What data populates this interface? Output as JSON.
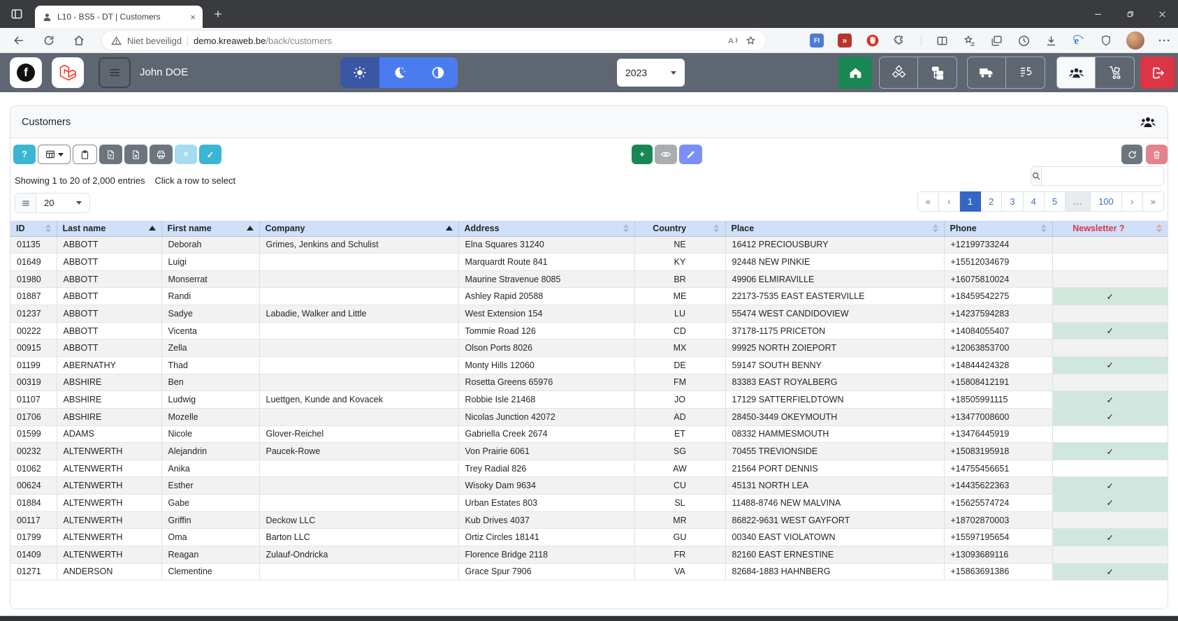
{
  "browser": {
    "tab_title": "L10 - BS5 - DT | Customers",
    "security_label": "Niet beveiligd",
    "url_host": "demo.kreaweb.be",
    "url_path": "/back/customers"
  },
  "header": {
    "user_name": "John DOE",
    "year": "2023"
  },
  "icons": {
    "close_tab": "×",
    "facebook_glyph": "f",
    "more": "···"
  },
  "panel": {
    "title": "Customers",
    "toolbar": {
      "help": "?",
      "clear": "×",
      "apply": "✓",
      "add": "+"
    },
    "info": {
      "showing": "Showing 1 to 20 of 2,000 entries",
      "hint": "Click a row to select"
    },
    "length_value": "20",
    "search_value": "",
    "pagination": {
      "first": "«",
      "prev": "‹",
      "next": "›",
      "last": "»",
      "pages": [
        "1",
        "2",
        "3",
        "4",
        "5",
        "…",
        "100"
      ],
      "active": "1"
    },
    "table": {
      "columns": [
        {
          "label": "ID",
          "sort": "both",
          "align": "left"
        },
        {
          "label": "Last name",
          "sort": "asc",
          "align": "left"
        },
        {
          "label": "First name",
          "sort": "asc",
          "align": "left"
        },
        {
          "label": "Company",
          "sort": "asc",
          "align": "left"
        },
        {
          "label": "Address",
          "sort": "both",
          "align": "left"
        },
        {
          "label": "Country",
          "sort": "both",
          "align": "center"
        },
        {
          "label": "Place",
          "sort": "both",
          "align": "left"
        },
        {
          "label": "Phone",
          "sort": "both",
          "align": "left"
        },
        {
          "label": "Newsletter ?",
          "sort": "both",
          "align": "center",
          "accent": "danger"
        }
      ],
      "check_glyph": "✓",
      "rows": [
        {
          "id": "01135",
          "last": "ABBOTT",
          "first": "Deborah",
          "company": "Grimes, Jenkins and Schulist",
          "address": "Elna Squares 31240",
          "country": "NE",
          "place": "16412 PRECIOUSBURY",
          "phone": "+12199733244",
          "newsletter": false
        },
        {
          "id": "01649",
          "last": "ABBOTT",
          "first": "Luigi",
          "company": "",
          "address": "Marquardt Route 841",
          "country": "KY",
          "place": "92448 NEW PINKIE",
          "phone": "+15512034679",
          "newsletter": false
        },
        {
          "id": "01980",
          "last": "ABBOTT",
          "first": "Monserrat",
          "company": "",
          "address": "Maurine Stravenue 8085",
          "country": "BR",
          "place": "49906 ELMIRAVILLE",
          "phone": "+16075810024",
          "newsletter": false
        },
        {
          "id": "01887",
          "last": "ABBOTT",
          "first": "Randi",
          "company": "",
          "address": "Ashley Rapid 20588",
          "country": "ME",
          "place": "22173-7535 EAST EASTERVILLE",
          "phone": "+18459542275",
          "newsletter": true
        },
        {
          "id": "01237",
          "last": "ABBOTT",
          "first": "Sadye",
          "company": "Labadie, Walker and Little",
          "address": "West Extension 154",
          "country": "LU",
          "place": "55474 WEST CANDIDOVIEW",
          "phone": "+14237594283",
          "newsletter": false
        },
        {
          "id": "00222",
          "last": "ABBOTT",
          "first": "Vicenta",
          "company": "",
          "address": "Tommie Road 126",
          "country": "CD",
          "place": "37178-1175 PRICETON",
          "phone": "+14084055407",
          "newsletter": true
        },
        {
          "id": "00915",
          "last": "ABBOTT",
          "first": "Zella",
          "company": "",
          "address": "Olson Ports 8026",
          "country": "MX",
          "place": "99925 NORTH ZOIEPORT",
          "phone": "+12063853700",
          "newsletter": false
        },
        {
          "id": "01199",
          "last": "ABERNATHY",
          "first": "Thad",
          "company": "",
          "address": "Monty Hills 12060",
          "country": "DE",
          "place": "59147 SOUTH BENNY",
          "phone": "+14844424328",
          "newsletter": true
        },
        {
          "id": "00319",
          "last": "ABSHIRE",
          "first": "Ben",
          "company": "",
          "address": "Rosetta Greens 65976",
          "country": "FM",
          "place": "83383 EAST ROYALBERG",
          "phone": "+15808412191",
          "newsletter": false
        },
        {
          "id": "01107",
          "last": "ABSHIRE",
          "first": "Ludwig",
          "company": "Luettgen, Kunde and Kovacek",
          "address": "Robbie Isle 21468",
          "country": "JO",
          "place": "17129 SATTERFIELDTOWN",
          "phone": "+18505991115",
          "newsletter": true
        },
        {
          "id": "01706",
          "last": "ABSHIRE",
          "first": "Mozelle",
          "company": "",
          "address": "Nicolas Junction 42072",
          "country": "AD",
          "place": "28450-3449 OKEYMOUTH",
          "phone": "+13477008600",
          "newsletter": true
        },
        {
          "id": "01599",
          "last": "ADAMS",
          "first": "Nicole",
          "company": "Glover-Reichel",
          "address": "Gabriella Creek 2674",
          "country": "ET",
          "place": "08332 HAMMESMOUTH",
          "phone": "+13476445919",
          "newsletter": false
        },
        {
          "id": "00232",
          "last": "ALTENWERTH",
          "first": "Alejandrin",
          "company": "Paucek-Rowe",
          "address": "Von Prairie 6061",
          "country": "SG",
          "place": "70455 TREVIONSIDE",
          "phone": "+15083195918",
          "newsletter": true
        },
        {
          "id": "01062",
          "last": "ALTENWERTH",
          "first": "Anika",
          "company": "",
          "address": "Trey Radial 826",
          "country": "AW",
          "place": "21564 PORT DENNIS",
          "phone": "+14755456651",
          "newsletter": false
        },
        {
          "id": "00624",
          "last": "ALTENWERTH",
          "first": "Esther",
          "company": "",
          "address": "Wisoky Dam 9634",
          "country": "CU",
          "place": "45131 NORTH LEA",
          "phone": "+14435622363",
          "newsletter": true
        },
        {
          "id": "01884",
          "last": "ALTENWERTH",
          "first": "Gabe",
          "company": "",
          "address": "Urban Estates 803",
          "country": "SL",
          "place": "11488-8746 NEW MALVINA",
          "phone": "+15625574724",
          "newsletter": true
        },
        {
          "id": "00117",
          "last": "ALTENWERTH",
          "first": "Griffin",
          "company": "Deckow LLC",
          "address": "Kub Drives 4037",
          "country": "MR",
          "place": "86822-9631 WEST GAYFORT",
          "phone": "+18702870003",
          "newsletter": false
        },
        {
          "id": "01799",
          "last": "ALTENWERTH",
          "first": "Oma",
          "company": "Barton LLC",
          "address": "Ortiz Circles 18141",
          "country": "GU",
          "place": "00340 EAST VIOLATOWN",
          "phone": "+15597195654",
          "newsletter": true
        },
        {
          "id": "01409",
          "last": "ALTENWERTH",
          "first": "Reagan",
          "company": "Zulauf-Ondricka",
          "address": "Florence Bridge 2118",
          "country": "FR",
          "place": "82160 EAST ERNESTINE",
          "phone": "+13093689116",
          "newsletter": false
        },
        {
          "id": "01271",
          "last": "ANDERSON",
          "first": "Clementine",
          "company": "",
          "address": "Grace Spur 7906",
          "country": "VA",
          "place": "82684-1883 HAHNBERG",
          "phone": "+15863691386",
          "newsletter": true
        }
      ]
    }
  },
  "colors": {
    "header_bg": "#5d6671",
    "success": "#198754",
    "danger": "#dc3545",
    "info": "#3ab6d3",
    "info_light": "#a5dcef",
    "secondary": "#6c757d",
    "accent_blue": "#3566c6",
    "link_blue": "#3b6fc9",
    "table_header_bg": "#cfe0f8",
    "check_bg": "#d1e7dd",
    "theme_active": "#3a57a4",
    "theme_blue": "#4a7cf0"
  }
}
